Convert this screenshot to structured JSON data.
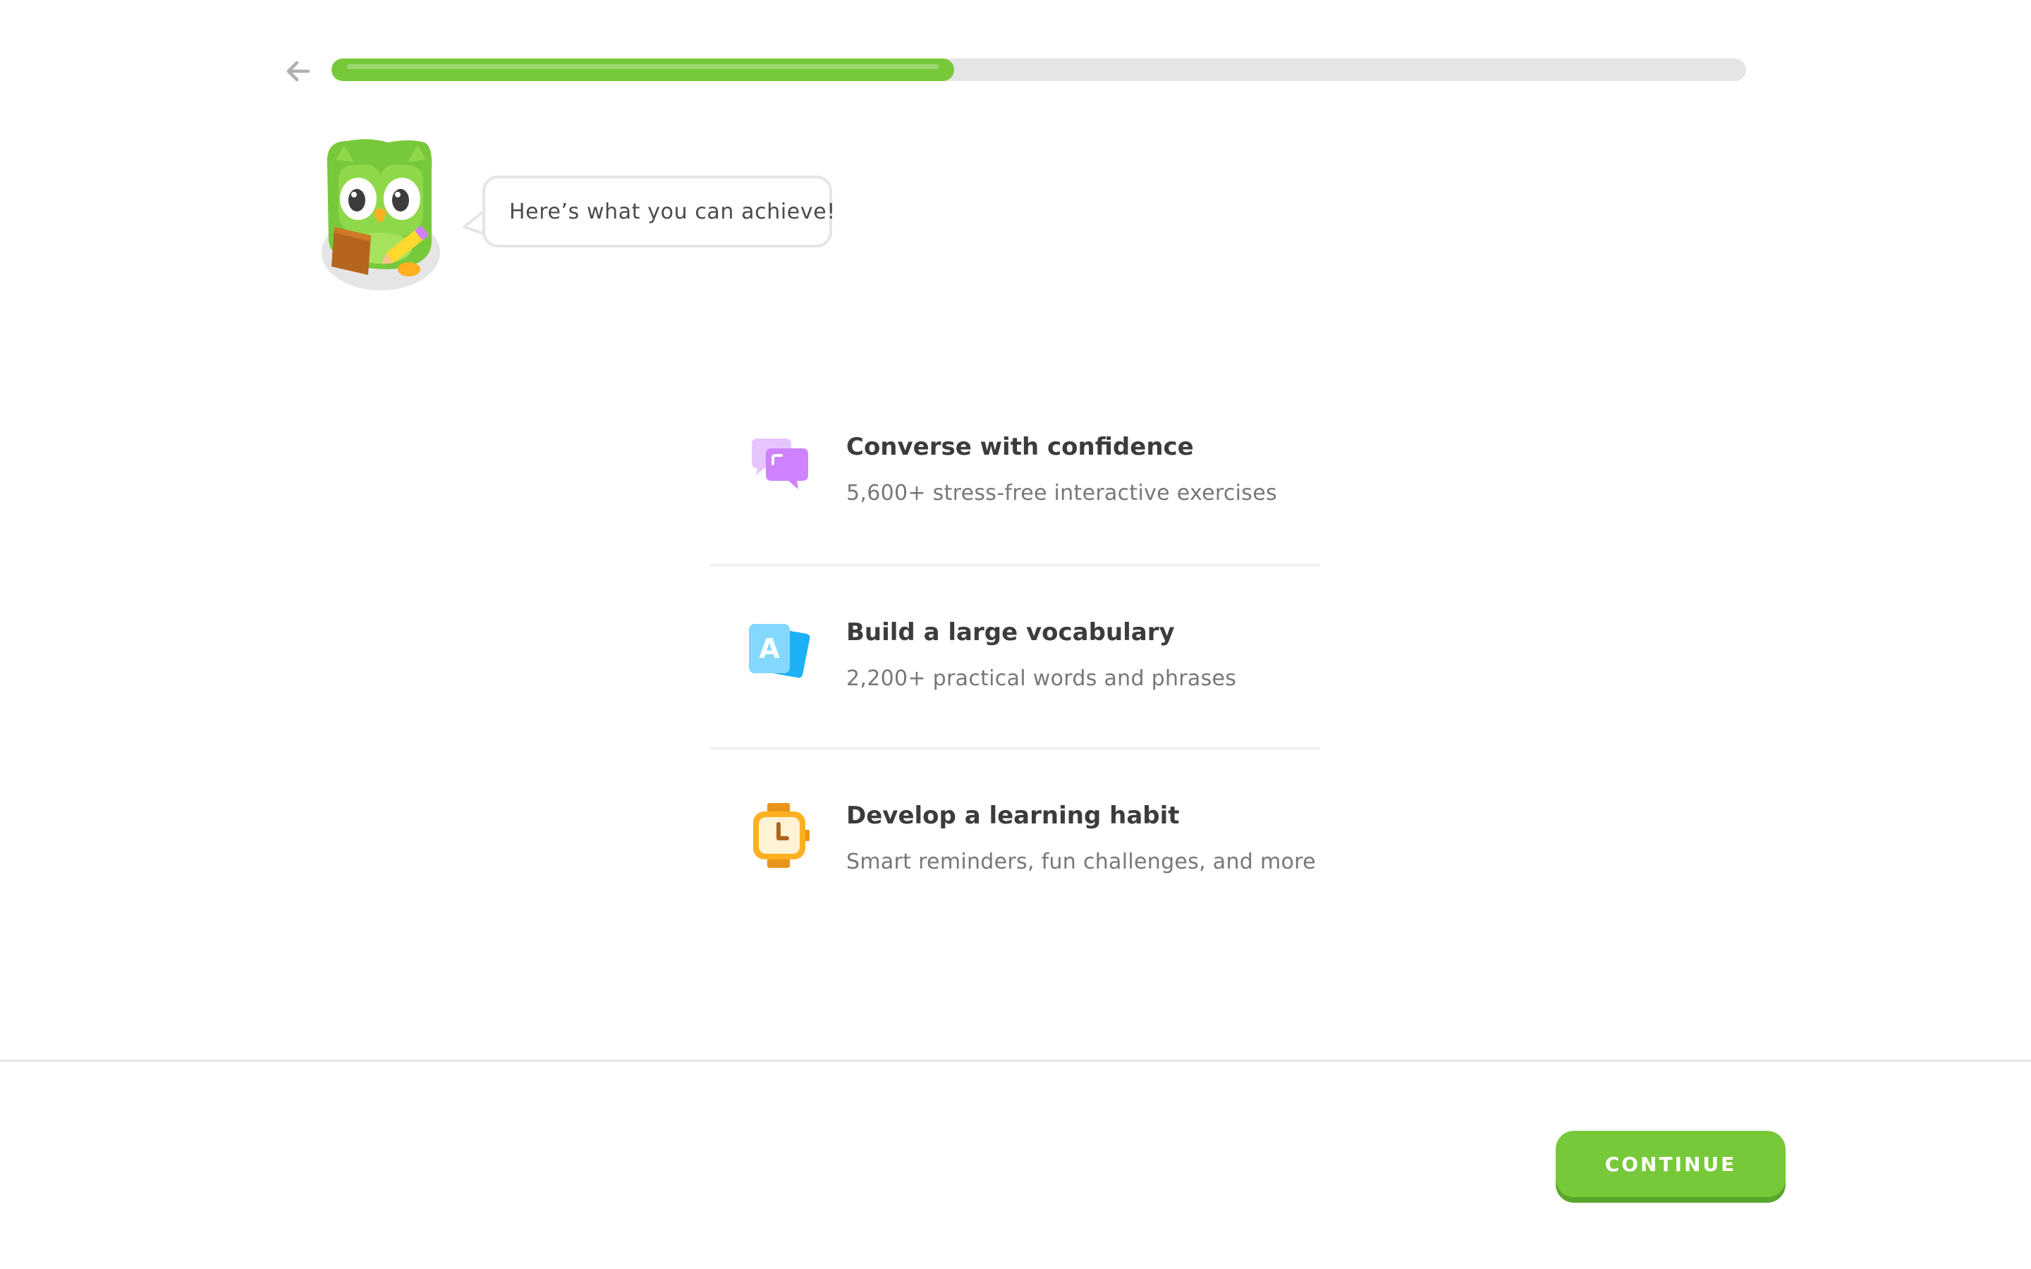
{
  "progress": {
    "fraction": 0.44,
    "fill_color": "#77c93a",
    "track_color": "#e5e5e5"
  },
  "header": {
    "back_icon": "arrow-left-icon"
  },
  "mascot": {
    "icon": "owl-mascot-icon",
    "speech": "Here’s what you can achieve!"
  },
  "features": [
    {
      "icon": "chat-bubbles-icon",
      "title": "Converse with confidence",
      "description": "5,600+ stress-free interactive exercises",
      "color": "#ce82ff"
    },
    {
      "icon": "vocabulary-cards-icon",
      "title": "Build a large vocabulary",
      "description": "2,200+ practical words and phrases",
      "color": "#1cb0f6"
    },
    {
      "icon": "watch-icon",
      "title": "Develop a learning habit",
      "description": "Smart reminders, fun challenges, and more",
      "color": "#ffb020"
    }
  ],
  "footer": {
    "continue_label": "CONTINUE",
    "button_color": "#77c93a"
  }
}
